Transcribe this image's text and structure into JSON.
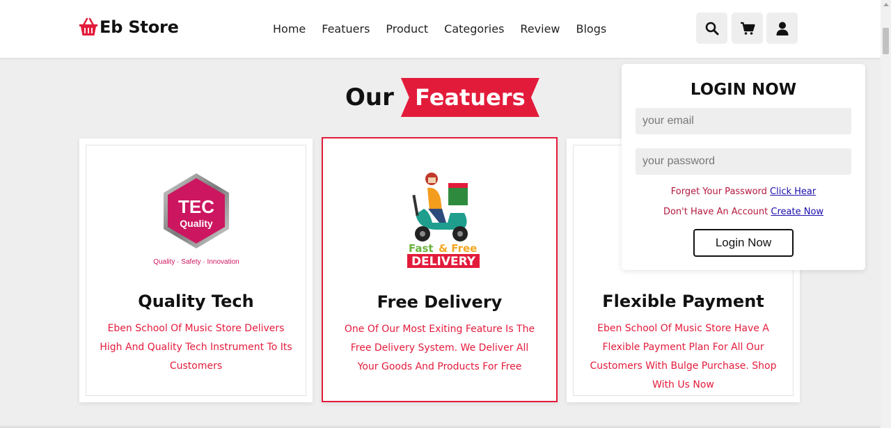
{
  "header": {
    "brand": "Eb Store",
    "logo_icon": "basket-icon",
    "nav": [
      "Home",
      "Featuers",
      "Product",
      "Categories",
      "Review",
      "Blogs"
    ],
    "icons": [
      "search-icon",
      "cart-icon",
      "user-icon"
    ]
  },
  "section": {
    "title_prefix": "Our",
    "title_badge": "Featuers"
  },
  "features": [
    {
      "title": "Quality Tech",
      "description": "Eben School Of Music Store Delivers High And Quality Tech Instrument To Its Customers",
      "image": {
        "badge_line1": "TEC",
        "badge_line2": "Quality",
        "tagline": "Quality · Safety · Innovation"
      }
    },
    {
      "title": "Free Delivery",
      "description": "One Of Our Most Exiting Feature Is The Free Delivery System. We Deliver All Your Goods And Products For Free",
      "image": {
        "line1_a": "Fast",
        "line1_b": "& Free",
        "line2": "DELIVERY"
      }
    },
    {
      "title": "Flexible Payment",
      "description": "Eben School Of Music Store Have A Flexible Payment Plan For All Our Customers With Bulge Purchase. Shop With Us Now"
    }
  ],
  "login": {
    "title": "LOGIN NOW",
    "email_placeholder": "your email",
    "password_placeholder": "your password",
    "forgot_text": "Forget Your Password",
    "forgot_link": "Click Hear",
    "account_text": "Don't Have An Account",
    "account_link": "Create Now",
    "button": "Login Now"
  },
  "colors": {
    "accent": "#e31b3b",
    "background": "#eeeeee",
    "link": "#1a0dab"
  }
}
